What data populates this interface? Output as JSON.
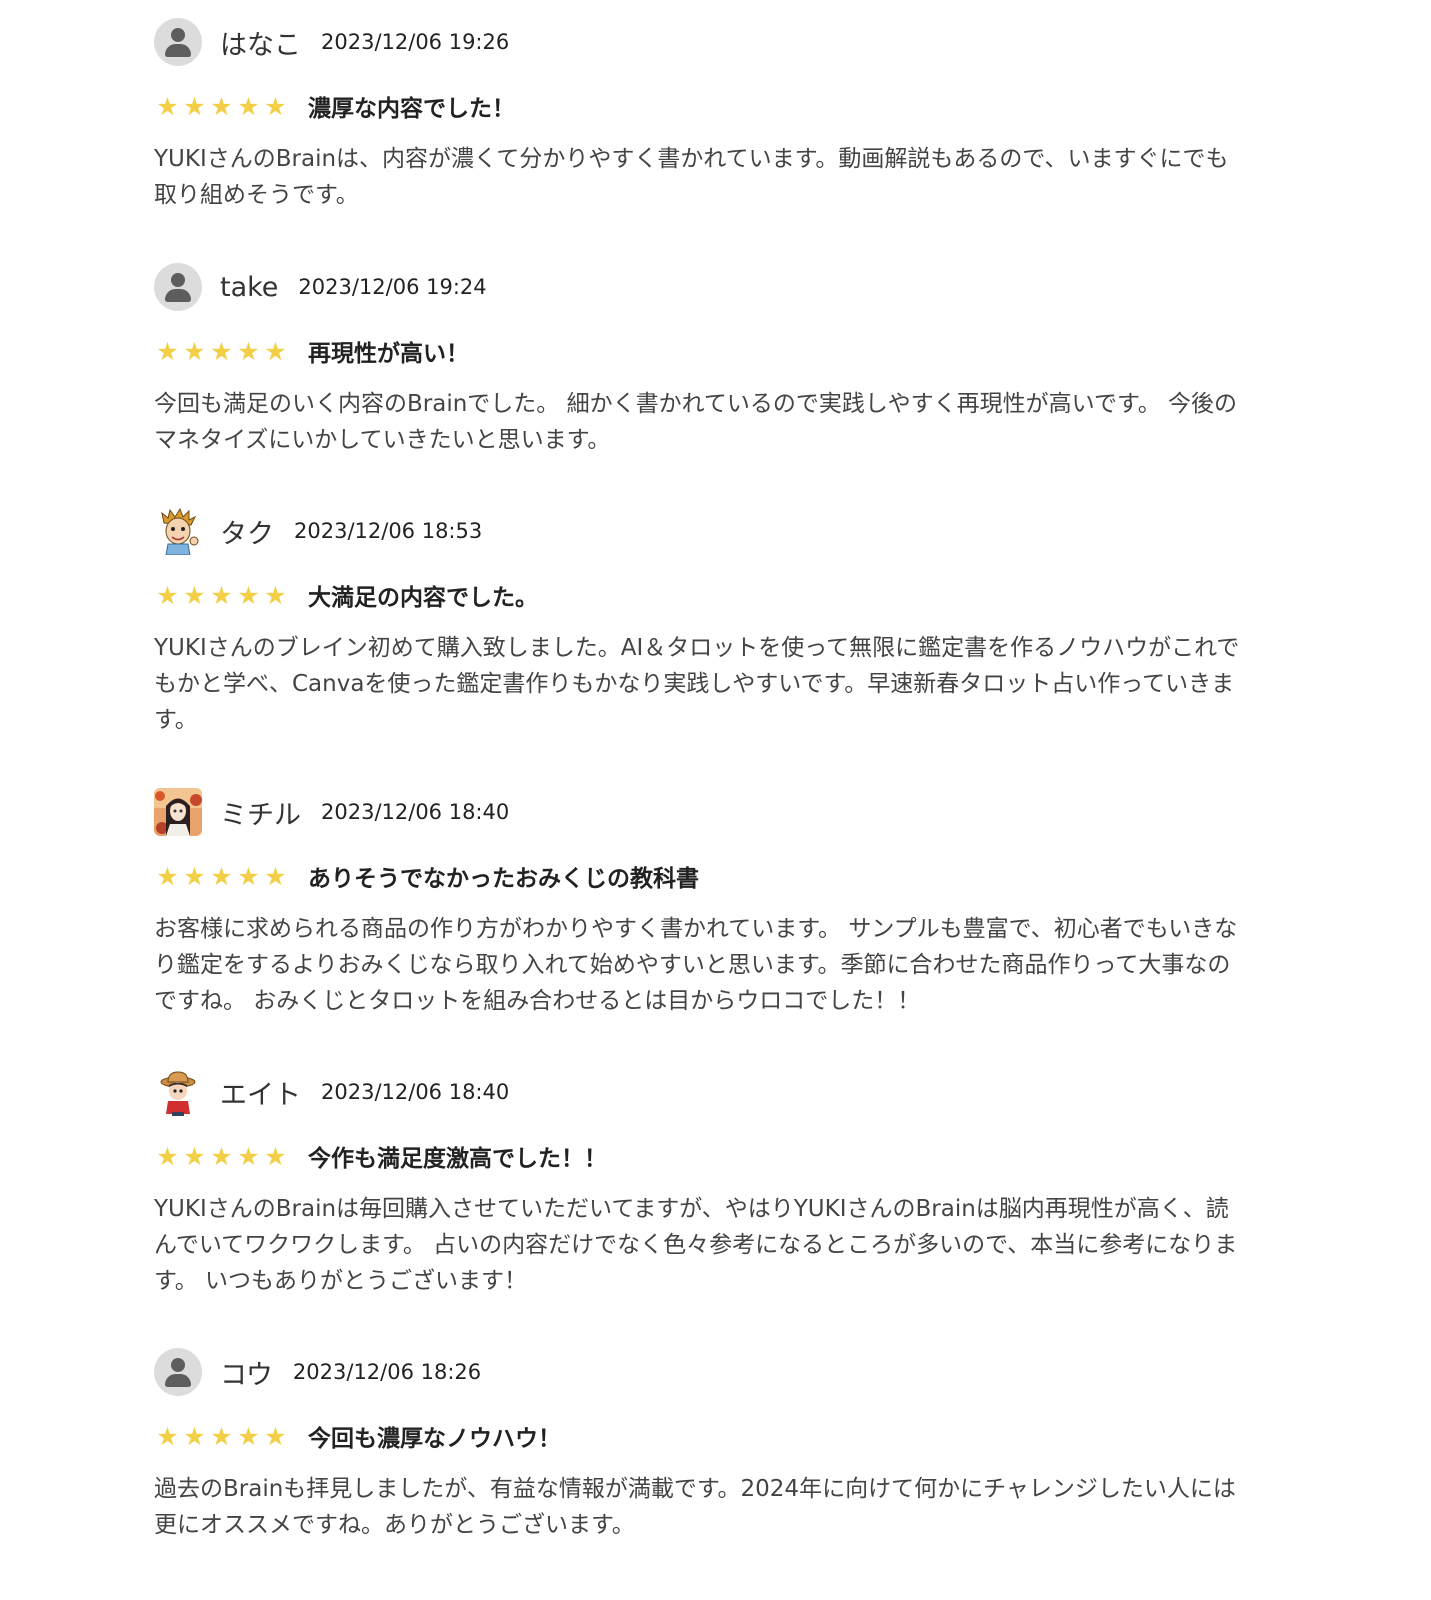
{
  "colors": {
    "star": "#f2cf47",
    "text": "#444444",
    "avatar_bg": "#dcdcdc",
    "avatar_fg": "#5d5d5d"
  },
  "rating_max": 5,
  "reviews": [
    {
      "user": "はなこ",
      "date": "2023/12/06 19:26",
      "avatar": "default-user-icon",
      "rating": 5,
      "title": "濃厚な内容でした！",
      "body": "YUKIさんのBrainは、内容が濃くて分かりやすく書かれています。動画解説もあるので、いますぐにでも取り組めそうです。"
    },
    {
      "user": "take",
      "date": "2023/12/06 19:24",
      "avatar": "default-user-icon",
      "rating": 5,
      "title": "再現性が高い！",
      "body": "今回も満足のいく内容のBrainでした。 細かく書かれているので実践しやすく再現性が高いです。 今後のマネタイズにいかしていきたいと思います。"
    },
    {
      "user": "タク",
      "date": "2023/12/06 18:53",
      "avatar": "cartoon-man-icon",
      "rating": 5,
      "title": "大満足の内容でした。",
      "body": "YUKIさんのブレイン初めて購入致しました。AI＆タロットを使って無限に鑑定書を作るノウハウがこれでもかと学べ、Canvaを使った鑑定書作りもかなり実践しやすいです。早速新春タロット占い作っていきます。"
    },
    {
      "user": "ミチル",
      "date": "2023/12/06 18:40",
      "avatar": "anime-girl-icon",
      "rating": 5,
      "title": "ありそうでなかったおみくじの教科書",
      "body": "お客様に求められる商品の作り方がわかりやすく書かれています。 サンプルも豊富で、初心者でもいきなり鑑定をするよりおみくじなら取り入れて始めやすいと思います。季節に合わせた商品作りって大事なのですね。 おみくじとタロットを組み合わせるとは目からウロコでした！！"
    },
    {
      "user": "エイト",
      "date": "2023/12/06 18:40",
      "avatar": "cartoon-boy-hat-icon",
      "rating": 5,
      "title": "今作も満足度激高でした！！",
      "body": "YUKIさんのBrainは毎回購入させていただいてますが、やはりYUKIさんのBrainは脳内再現性が高く、読んでいてワクワクします。 占いの内容だけでなく色々参考になるところが多いので、本当に参考になります。 いつもありがとうございます！"
    },
    {
      "user": "コウ",
      "date": "2023/12/06 18:26",
      "avatar": "default-user-icon",
      "rating": 5,
      "title": "今回も濃厚なノウハウ！",
      "body": "過去のBrainも拝見しましたが、有益な情報が満載です。2024年に向けて何かにチャレンジしたい人には更にオススメですね。ありがとうございます。"
    }
  ]
}
